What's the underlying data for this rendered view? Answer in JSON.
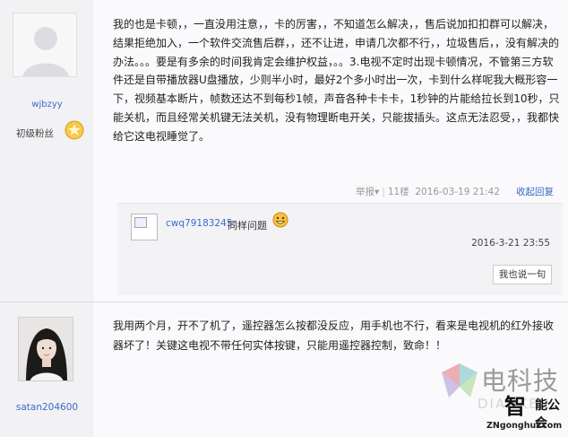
{
  "post1": {
    "username": "wjbzyy",
    "rank": "初级粉丝",
    "body": "我的也是卡顿，，一直没用注意，，卡的厉害，，不知道怎么解决，，售后说加扣扣群可以解决，结果拒绝加入，一个软件交流售后群，，还不让进，申请几次都不行，，垃圾售后，，没有解决的办法。。。要是有多余的时间我肯定会维护权益，。。3.电视不定时出现卡顿情况，不管第三方软件还是自带播放器U盘播放，少则半小时，最好2个多小时出一次，卡到什么样呢我大概形容一下，视频基本断片，帧数还达不到每秒1帧，声音各种卡卡卡，1秒钟的片能给拉长到10秒，只能关机，而且经常关机键无法关机，没有物理断电开关，只能拔插头。这点无法忍受，，我都快给它这电视睡觉了。",
    "report": "举报",
    "report_caret": "▾",
    "floor": "11楼",
    "time": "2016-03-19 21:42",
    "collapse_reply": "收起回复",
    "reply": {
      "user": "cwq79183245:",
      "text": "同样问题",
      "time": "2016-3-21 23:55",
      "button": "我也说一句"
    }
  },
  "post2": {
    "username": "satan204600",
    "body": "我用两个月，开不了机了，遥控器怎么按都没反应，用手机也不行，看来是电视机的红外接收器坏了！关键这电视不带任何实体按键，只能用遥控器控制，致命！！"
  },
  "watermark": {
    "title": "电科技",
    "ghost": "DIANKEJI",
    "brand": "智",
    "brand2": "能公会",
    "url": "ZNgonghui.com"
  }
}
